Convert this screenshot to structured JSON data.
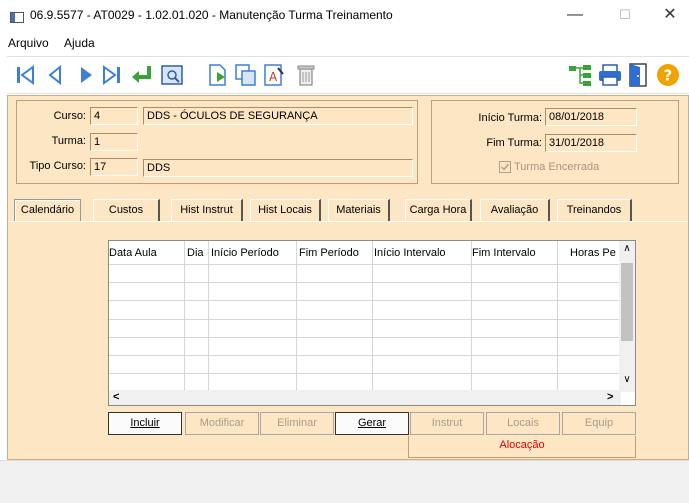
{
  "window": {
    "title": "06.9.5577 - AT0029 - 1.02.01.020 - Manutenção Turma Treinamento",
    "minimize": "—",
    "maximize": "☐",
    "close": "✕"
  },
  "menu": {
    "items": [
      "Arquivo",
      "Ajuda"
    ]
  },
  "toolbar": {
    "icons": [
      "first-record",
      "previous-record",
      "next-record",
      "last-record",
      "return",
      "zoom",
      "new",
      "copy",
      "edit",
      "delete",
      "tree",
      "print",
      "exit",
      "help"
    ],
    "colors": {
      "nav": "#3f7fd8",
      "green": "#3aa335",
      "help": "#f0a300"
    }
  },
  "header": {
    "curso_label": "Curso:",
    "curso_code": "4",
    "curso_desc": "DDS - ÓCULOS DE SEGURANÇA",
    "turma_label": "Turma:",
    "turma_value": "1",
    "tipo_label": "Tipo Curso:",
    "tipo_code": "17",
    "tipo_desc": "DDS",
    "inicio_label": "Início Turma:",
    "inicio_value": "08/01/2018",
    "fim_label": "Fim Turma:",
    "fim_value": "31/01/2018",
    "encerrada_label": "Turma Encerrada",
    "encerrada_checked": true
  },
  "tabs": [
    "Calendário",
    "Custos",
    "Hist Instrut",
    "Hist Locais",
    "Materiais",
    "Carga Hora",
    "Avaliação",
    "Treinandos"
  ],
  "grid": {
    "columns": [
      "Data Aula",
      "Dia",
      "Início Período",
      "Fim Período",
      "Início Intervalo",
      "Fim Intervalo",
      "Horas Pe"
    ],
    "scroll_up": "∧",
    "scroll_down": "∨",
    "scroll_left": "<",
    "scroll_right": ">"
  },
  "buttons": {
    "incluir": "Incluir",
    "modificar": "Modificar",
    "eliminar": "Eliminar",
    "gerar": "Gerar",
    "instrut": "Instrut",
    "locais": "Locais",
    "equip": "Equip"
  },
  "alocacao_label": "Alocação"
}
